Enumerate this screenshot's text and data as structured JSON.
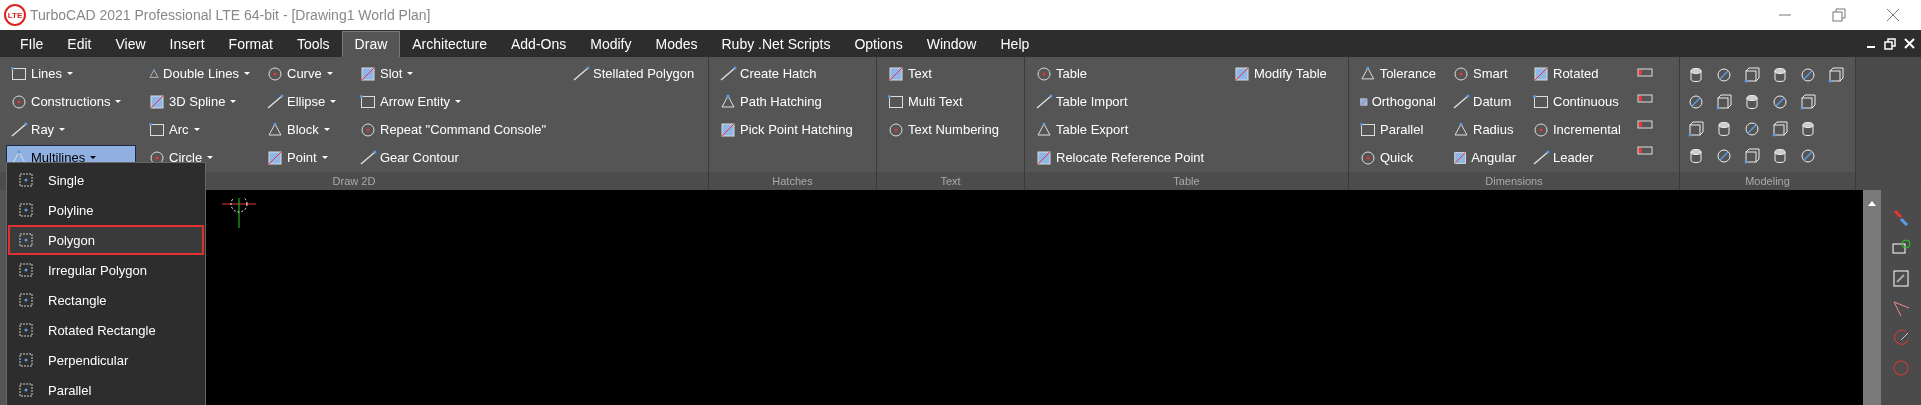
{
  "window": {
    "logo": "LTE",
    "title": "TurboCAD 2021 Professional LTE 64-bit - [Drawing1 World Plan]"
  },
  "menu": [
    {
      "label": "FIle",
      "selected": false
    },
    {
      "label": "Edit",
      "selected": false
    },
    {
      "label": "View",
      "selected": false
    },
    {
      "label": "Insert",
      "selected": false
    },
    {
      "label": "Format",
      "selected": false
    },
    {
      "label": "Tools",
      "selected": false
    },
    {
      "label": "Draw",
      "selected": true
    },
    {
      "label": "Architecture",
      "selected": false
    },
    {
      "label": "Add-Ons",
      "selected": false
    },
    {
      "label": "Modify",
      "selected": false
    },
    {
      "label": "Modes",
      "selected": false
    },
    {
      "label": "Ruby .Net Scripts",
      "selected": false
    },
    {
      "label": "Options",
      "selected": false
    },
    {
      "label": "Window",
      "selected": false
    },
    {
      "label": "Help",
      "selected": false
    }
  ],
  "ribbon": [
    {
      "label": "Draw 2D",
      "kind": "tools",
      "columns": [
        [
          {
            "label": "Lines",
            "dropdown": true,
            "open": false
          },
          {
            "label": "Constructions",
            "dropdown": true,
            "open": false
          },
          {
            "label": "Ray",
            "dropdown": true,
            "open": false
          },
          {
            "label": "Multilines",
            "dropdown": true,
            "open": true
          }
        ],
        [
          {
            "label": "Double Lines",
            "dropdown": true,
            "open": false
          },
          {
            "label": "3D Spline",
            "dropdown": true,
            "open": false
          },
          {
            "label": "Arc",
            "dropdown": true,
            "open": false
          },
          {
            "label": "Circle",
            "dropdown": true,
            "open": false
          }
        ],
        [
          {
            "label": "Curve",
            "dropdown": true,
            "open": false
          },
          {
            "label": "Ellipse",
            "dropdown": true,
            "open": false
          },
          {
            "label": "Block",
            "dropdown": true,
            "open": false
          },
          {
            "label": "Point",
            "dropdown": true,
            "open": false
          }
        ],
        [
          {
            "label": "Slot",
            "dropdown": true,
            "open": false
          },
          {
            "label": "Arrow Entity",
            "dropdown": true,
            "open": false
          },
          {
            "label": "Repeat \"Command Console\""
          },
          {
            "label": "Gear Contour"
          }
        ],
        [
          {
            "label": "Stellated Polygon"
          }
        ]
      ]
    },
    {
      "label": "Hatches",
      "kind": "tools",
      "columns": [
        [
          {
            "label": "Create Hatch"
          },
          {
            "label": "Path Hatching"
          },
          {
            "label": "Pick Point Hatching"
          }
        ]
      ]
    },
    {
      "label": "Text",
      "kind": "tools",
      "columns": [
        [
          {
            "label": "Text"
          },
          {
            "label": "Multi Text"
          },
          {
            "label": "Text Numbering"
          }
        ]
      ]
    },
    {
      "label": "Table",
      "kind": "tools",
      "columns": [
        [
          {
            "label": "Table"
          },
          {
            "label": "Table Import"
          },
          {
            "label": "Table Export"
          },
          {
            "label": "Relocate Reference Point"
          }
        ],
        [
          {
            "label": "Modify Table"
          }
        ]
      ]
    },
    {
      "label": "Dimensions",
      "kind": "dimensions",
      "columns": [
        [
          {
            "label": "Tolerance"
          },
          {
            "label": "Orthogonal"
          },
          {
            "label": "Parallel"
          },
          {
            "label": "Quick"
          }
        ],
        [
          {
            "label": "Smart"
          },
          {
            "label": "Datum"
          },
          {
            "label": "Radius"
          },
          {
            "label": "Angular"
          }
        ],
        [
          {
            "label": "Rotated"
          },
          {
            "label": "Continuous"
          },
          {
            "label": "Incremental"
          },
          {
            "label": "Leader"
          }
        ]
      ]
    },
    {
      "label": "Modeling",
      "kind": "modeling"
    }
  ],
  "popup": [
    {
      "label": "Single",
      "marked": false
    },
    {
      "label": "Polyline",
      "marked": false
    },
    {
      "label": "Polygon",
      "marked": true
    },
    {
      "label": "Irregular Polygon",
      "marked": false
    },
    {
      "label": "Rectangle",
      "marked": false
    },
    {
      "label": "Rotated Rectangle",
      "marked": false
    },
    {
      "label": "Perpendicular",
      "marked": false
    },
    {
      "label": "Parallel",
      "marked": false
    }
  ]
}
